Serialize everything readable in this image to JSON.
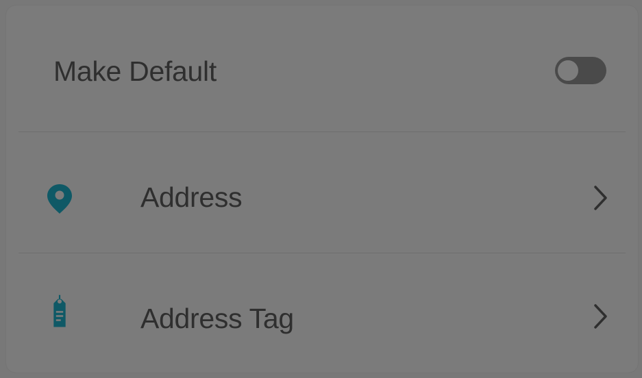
{
  "settings": {
    "make_default": {
      "label": "Make Default",
      "toggle_on": false
    },
    "rows": [
      {
        "label": "Address",
        "icon": "location-pin-icon"
      },
      {
        "label": "Address Tag",
        "icon": "tag-icon"
      }
    ]
  },
  "colors": {
    "icon_accent": "#0f5966",
    "text": "#2f2f2f",
    "toggle_track": "#4a4a4a"
  }
}
